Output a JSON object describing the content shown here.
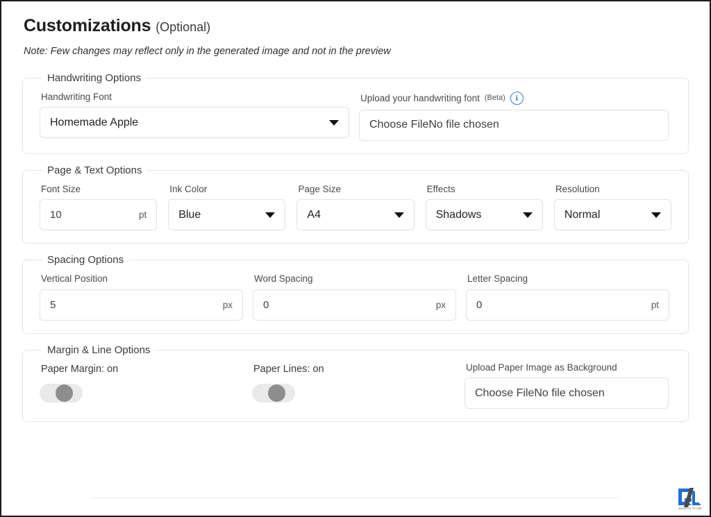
{
  "header": {
    "title": "Customizations",
    "optional": "(Optional)",
    "note": "Note: Few changes may reflect only in the generated image and not in the preview"
  },
  "groups": {
    "handwriting": {
      "legend": "Handwriting Options",
      "font_label": "Handwriting Font",
      "font_value": "Homemade Apple",
      "upload_label": "Upload your handwriting font",
      "upload_beta": "(Beta)",
      "upload_info_icon": "info-icon",
      "upload_value": "Choose FileNo file chosen"
    },
    "page_text": {
      "legend": "Page & Text Options",
      "fields": [
        {
          "label": "Font Size",
          "value": "10",
          "unit": "pt",
          "type": "number"
        },
        {
          "label": "Ink Color",
          "value": "Blue",
          "unit": "",
          "type": "select"
        },
        {
          "label": "Page Size",
          "value": "A4",
          "unit": "",
          "type": "select"
        },
        {
          "label": "Effects",
          "value": "Shadows",
          "unit": "",
          "type": "select"
        },
        {
          "label": "Resolution",
          "value": "Normal",
          "unit": "",
          "type": "select"
        }
      ]
    },
    "spacing": {
      "legend": "Spacing Options",
      "fields": [
        {
          "label": "Vertical Position",
          "value": "5",
          "unit": "px"
        },
        {
          "label": "Word Spacing",
          "value": "0",
          "unit": "px"
        },
        {
          "label": "Letter Spacing",
          "value": "0",
          "unit": "pt"
        }
      ]
    },
    "margin_line": {
      "legend": "Margin & Line Options",
      "paper_margin_label": "Paper Margin: on",
      "paper_lines_label": "Paper Lines: on",
      "upload_bg_label": "Upload Paper Image as Background",
      "upload_bg_value": "Choose FileNo file chosen"
    }
  },
  "watermark": {
    "text": "GADGETS TO USE"
  },
  "colors": {
    "accent_blue": "#2a7ec4",
    "logo_blue": "#1f6fd0",
    "border": "#e2e2e4",
    "text": "#202124"
  }
}
